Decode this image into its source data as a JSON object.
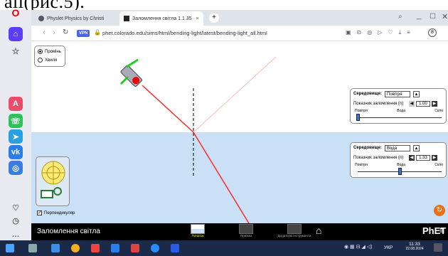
{
  "crop_caption": "ali(рис.5).",
  "tabs": [
    {
      "title": "Physlet Physics by Christi"
    },
    {
      "title": "Заломлення світла 1.1.35"
    }
  ],
  "address": {
    "url": "phet.colorado.edu/sims/html/bending-light/latest/bending-light_all.html",
    "vpn": "VPN"
  },
  "mode": {
    "options": [
      "Промінь",
      "Хвиля"
    ],
    "selected": "Промінь"
  },
  "top_medium": {
    "label": "Середовище:",
    "value": "Повітря",
    "index_label": "Показник заломлення (n)",
    "index_value": "1.00",
    "scale": [
      "Повітря",
      "Вода",
      "Скло"
    ],
    "index_fraction": 0.0
  },
  "bottom_medium": {
    "label": "Середовище:",
    "value": "Вода",
    "index_label": "Показник заломлення (n)",
    "index_value": "1.33",
    "scale": [
      "Повітря",
      "Вода",
      "Скло"
    ],
    "index_fraction": 0.5
  },
  "normal_checkbox": {
    "label": "Перпендикуляр",
    "checked": true
  },
  "app_title": "Заломлення світла",
  "nav": [
    {
      "label": "Початок"
    },
    {
      "label": "Призми"
    },
    {
      "label": "Додаткові інструменти"
    }
  ],
  "phet_logo": "PhET",
  "taskbar": {
    "lang": "УКР",
    "time": "11:33",
    "date": "22.08.2024"
  },
  "colors": {
    "laser": "#ff2a2a",
    "water": "#c9e0f6",
    "accent": "#e8701a"
  }
}
